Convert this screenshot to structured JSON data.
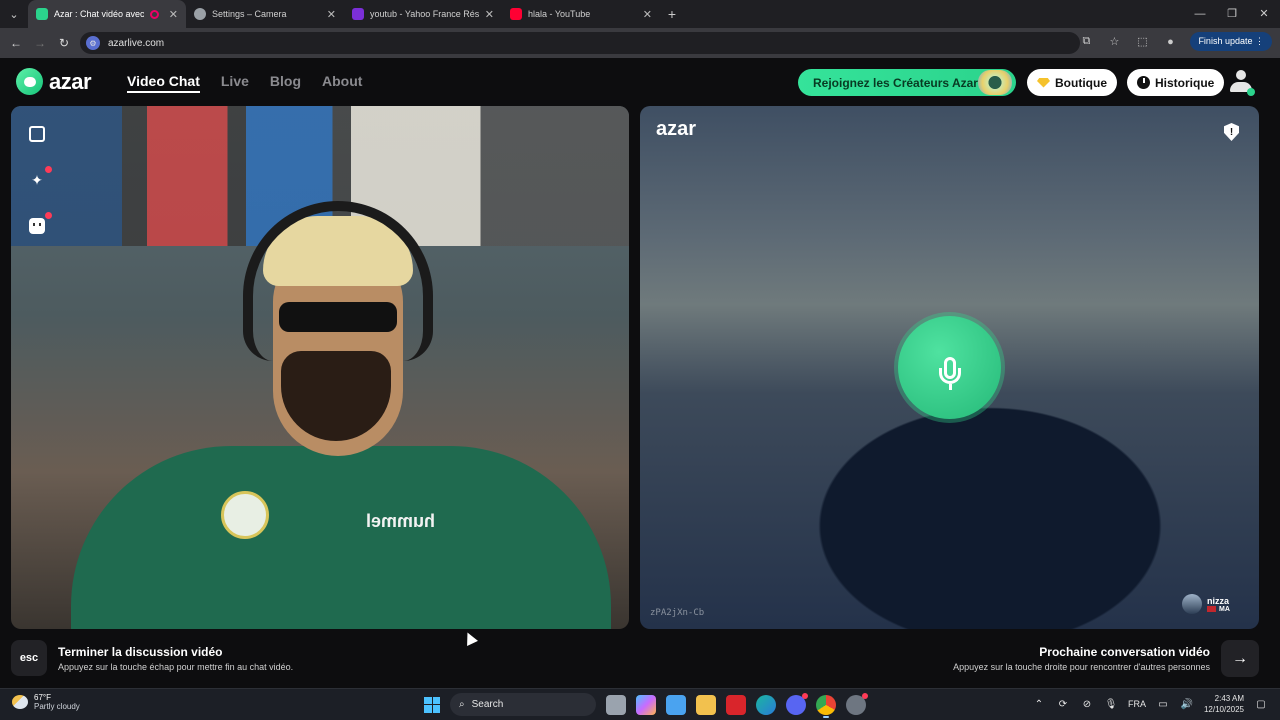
{
  "browser": {
    "tabs": [
      {
        "title": "Azar : Chat vidéo avec de n",
        "favicon_color": "#2bd38c",
        "active": true,
        "recording": true
      },
      {
        "title": "Settings – Camera",
        "favicon_color": "#9aa0a6",
        "active": false
      },
      {
        "title": "youtub - Yahoo France Résultat",
        "favicon_color": "#7b2fd8",
        "active": false
      },
      {
        "title": "hlala - YouTube",
        "favicon_color": "#ff0033",
        "active": false
      }
    ],
    "url": "azarlive.com",
    "finish_update_label": "Finish update"
  },
  "app": {
    "logo_text": "azar",
    "nav": [
      {
        "label": "Video Chat",
        "active": true
      },
      {
        "label": "Live",
        "active": false
      },
      {
        "label": "Blog",
        "active": false
      },
      {
        "label": "About",
        "active": false
      }
    ],
    "creators_label": "Rejoignez les Créateurs Azar",
    "shop_label": "Boutique",
    "history_label": "Historique",
    "accent_color": "#2bd38c"
  },
  "remote": {
    "logo_text": "azar",
    "peer_id": "zPA2jXn-Cb",
    "peer_name": "nizza",
    "peer_country": "MA"
  },
  "controls": {
    "esc_key": "esc",
    "end_title": "Terminer la discussion vidéo",
    "end_hint": "Appuyez sur la touche échap pour mettre fin au chat vidéo.",
    "next_title": "Prochaine conversation vidéo",
    "next_hint": "Appuyez sur la touche droite pour rencontrer d'autres personnes"
  },
  "taskbar": {
    "weather_temp": "67°F",
    "weather_desc": "Partly cloudy",
    "search_placeholder": "Search",
    "language": "FRA",
    "time": "2:43 AM",
    "date": "12/10/2025"
  }
}
